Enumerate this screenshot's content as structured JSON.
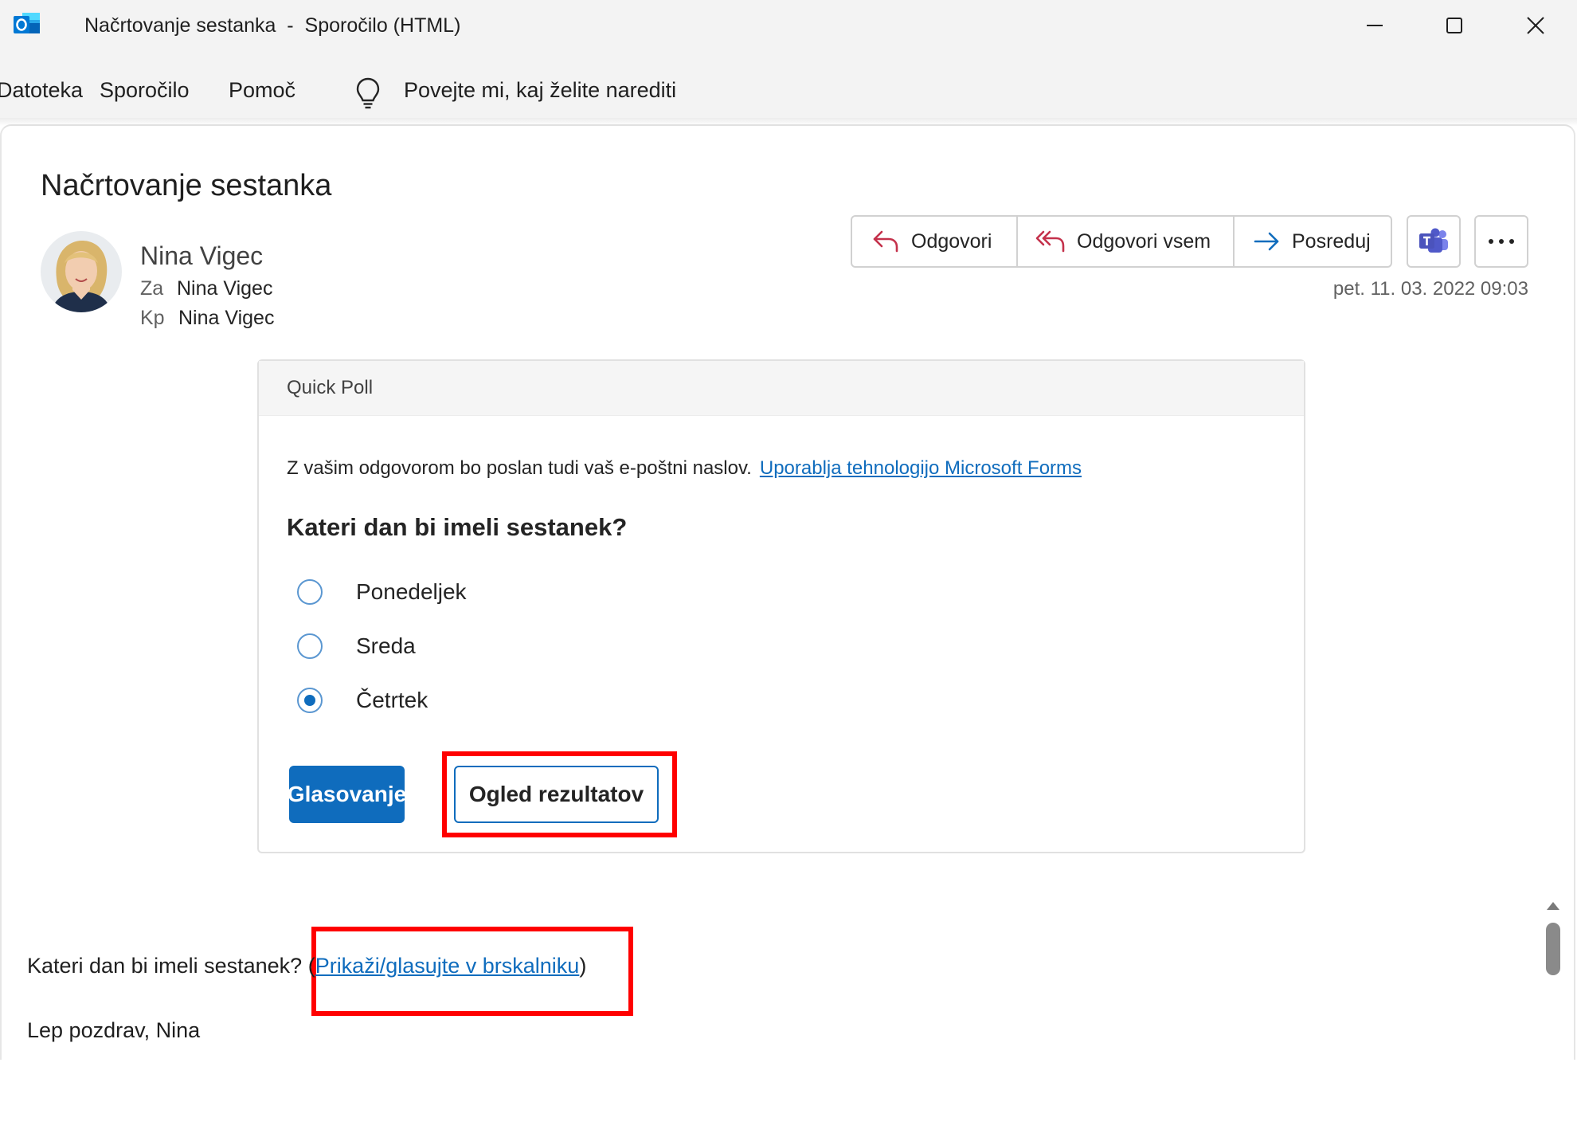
{
  "window": {
    "title": "Načrtovanje sestanka  -  Sporočilo (HTML)"
  },
  "menu": {
    "items": [
      "Datoteka",
      "Sporočilo",
      "Pomoč"
    ],
    "tell_me": "Povejte mi, kaj želite narediti"
  },
  "message": {
    "subject": "Načrtovanje sestanka",
    "sender": "Nina Vigec",
    "to_label": "Za",
    "to_value": "Nina Vigec",
    "cc_label": "Kp",
    "cc_value": "Nina Vigec",
    "date": "pet. 11. 03. 2022 09:03"
  },
  "actions": {
    "reply": "Odgovori",
    "reply_all": "Odgovori vsem",
    "forward": "Posreduj"
  },
  "poll": {
    "header": "Quick Poll",
    "notice": "Z vašim odgovorom bo poslan tudi vaš e-poštni naslov.",
    "notice_link": "Uporablja tehnologijo Microsoft Forms",
    "question": "Kateri dan bi imeli sestanek?",
    "options": [
      {
        "label": "Ponedeljek",
        "checked": false
      },
      {
        "label": "Sreda",
        "checked": false
      },
      {
        "label": "Četrtek",
        "checked": true
      }
    ],
    "vote_button": "Glasovanje",
    "results_button": "Ogled rezultatov"
  },
  "body": {
    "question_text": "Kateri dan bi imeli sestanek?",
    "paren_open": " (",
    "browser_link": "Prikaži/glasujte v brskalniku",
    "paren_close": ")",
    "signature": "Lep pozdrav, Nina"
  },
  "icons": {
    "app": "outlook-icon",
    "bulb": "lightbulb-icon",
    "reply": "reply-arrow-icon",
    "reply_all": "reply-all-arrow-icon",
    "forward": "forward-arrow-icon",
    "teams": "teams-icon",
    "more": "ellipsis-icon"
  },
  "colors": {
    "accent": "#0f6cbd",
    "highlight": "#ff0000",
    "titlebar": "#f3f3f3"
  }
}
